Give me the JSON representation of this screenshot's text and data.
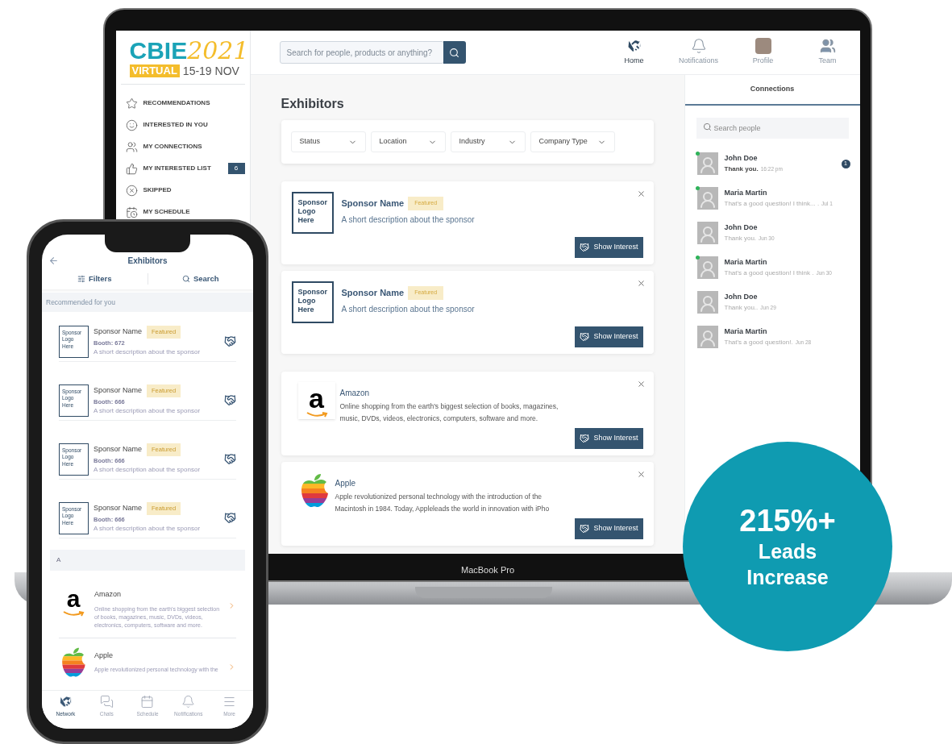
{
  "laptop": {
    "label": "MacBook Pro",
    "brand": {
      "name": "CBIE",
      "year": "2021",
      "edition": "VIRTUAL",
      "dates": "15-19 NOV"
    },
    "search": {
      "placeholder": "Search for people, products or anything?"
    },
    "nav": [
      {
        "kind": "home",
        "label": "Home",
        "selected": true
      },
      {
        "kind": "bell",
        "label": "Notifications",
        "selected": false
      },
      {
        "kind": "avatar",
        "label": "Profile",
        "selected": false
      },
      {
        "kind": "team",
        "label": "Team",
        "selected": false
      }
    ],
    "sidebar": {
      "items": [
        {
          "kind": "star",
          "label": "RECOMMENDATIONS"
        },
        {
          "kind": "smile",
          "label": "INTERESTED IN YOU"
        },
        {
          "kind": "users",
          "label": "MY CONNECTIONS"
        },
        {
          "kind": "thumb",
          "label": "MY INTERESTED LIST",
          "count": "6"
        },
        {
          "kind": "skip",
          "label": "SKIPPED"
        },
        {
          "kind": "calendar",
          "label": "MY SCHEDULE"
        }
      ]
    },
    "title": "Exhibitors",
    "filters": [
      "Status",
      "Location",
      "Industry",
      "Company Type"
    ],
    "cards": [
      {
        "kind": "sponsor",
        "logo_text": "Sponsor Logo Here",
        "name": "Sponsor Name",
        "badge": "Featured",
        "description": "A short description about the sponsor",
        "button": "Show Interest"
      },
      {
        "kind": "sponsor",
        "logo_text": "Sponsor Logo Here",
        "name": "Sponsor Name",
        "badge": "Featured",
        "description": "A short description about the sponsor",
        "button": "Show Interest"
      },
      {
        "kind": "company",
        "logo": {
          "kind": "amazon",
          "text": "a"
        },
        "name": "Amazon",
        "description": "Online shopping from the earth's biggest selection of books, magazines, music, DVDs, videos, electronics, computers, software and more.",
        "button": "Show Interest"
      },
      {
        "kind": "company",
        "logo": {
          "kind": "apple"
        },
        "name": "Apple",
        "description": "Apple revolutionized personal technology with the introduction of the Macintosh in 1984. Today, Appleleads the world in innovation with iPho",
        "button": "Show Interest"
      }
    ],
    "connections": {
      "title": "Connections",
      "search": {
        "placeholder": "Search people"
      },
      "items": [
        {
          "name": "John Doe",
          "message": "Thank you.",
          "time": "16:22 pm",
          "online": true,
          "unread": "1"
        },
        {
          "name": "Maria Martin",
          "message": "That's a good question! I think... .",
          "time": "Jul 1",
          "online": true
        },
        {
          "name": "John Doe",
          "message": "Thank you.",
          "time": "Jun 30",
          "online": false
        },
        {
          "name": "Maria Martin",
          "message": "That's a good question! I think .",
          "time": "Jun 30",
          "online": true
        },
        {
          "name": "John Doe",
          "message": "Thank you..",
          "time": "Jun 29",
          "online": false
        },
        {
          "name": "Maria Martin",
          "message": "That's a good question!.",
          "time": "Jun 28",
          "online": false
        }
      ]
    }
  },
  "phone": {
    "title": "Exhibitors",
    "actions": [
      {
        "kind": "filters",
        "label": "Filters"
      },
      {
        "kind": "search",
        "label": "Search"
      }
    ],
    "section": "Recommended for you",
    "sponsors": [
      {
        "logo_text": "Sponsor Logo Here",
        "name": "Sponsor Name",
        "badge": "Featured",
        "booth": "Booth: 672",
        "description": "A short description about the sponsor"
      },
      {
        "logo_text": "Sponsor Logo Here",
        "name": "Sponsor Name",
        "badge": "Featured",
        "booth": "Booth: 666",
        "description": "A short description about the sponsor"
      },
      {
        "logo_text": "Sponsor Logo Here",
        "name": "Sponsor Name",
        "badge": "Featured",
        "booth": "Booth: 666",
        "description": "A short description about the sponsor"
      },
      {
        "logo_text": "Sponsor Logo Here",
        "name": "Sponsor Name",
        "badge": "Featured",
        "booth": "Booth: 666",
        "description": "A short description about the sponsor"
      }
    ],
    "letter": "A",
    "companies": [
      {
        "logo": {
          "kind": "amazon",
          "text": "a"
        },
        "name": "Amazon",
        "description": "Online shopping from the earth's biggest selection of books, magazines, music, DVDs, videos, electronics, computers, software and more."
      },
      {
        "logo": {
          "kind": "apple"
        },
        "name": "Apple",
        "description": "Apple revolutionized personal technology with the"
      }
    ],
    "tabs": [
      {
        "kind": "network",
        "label": "Network",
        "selected": true
      },
      {
        "kind": "chats",
        "label": "Chats",
        "selected": false
      },
      {
        "kind": "schedule",
        "label": "Schedule",
        "selected": false
      },
      {
        "kind": "bell",
        "label": "Notifications",
        "selected": false
      },
      {
        "kind": "more",
        "label": "More",
        "selected": false
      }
    ]
  },
  "badge": {
    "value": "215%+",
    "line_1": "Leads",
    "line_2": "Increase"
  }
}
